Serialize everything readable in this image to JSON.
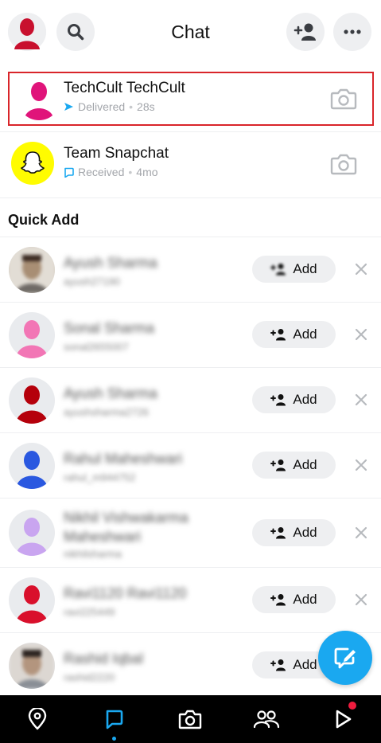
{
  "header": {
    "title": "Chat",
    "avatar_icon": "bitmoji-avatar-icon",
    "search_icon": "search-icon",
    "add_friend_icon": "add-friend-icon",
    "more_icon": "more-icon"
  },
  "chats": [
    {
      "name": "TechCult TechCult",
      "status": "Delivered",
      "time": "28s",
      "status_color": "#1aa8f0",
      "avatar_color": "#e0147a"
    },
    {
      "name": "Team Snapchat",
      "status": "Received",
      "time": "4mo",
      "status_color": "#1aa8f0",
      "avatar_color": "#fffc00"
    }
  ],
  "separator": "•",
  "quick_add": {
    "title": "Quick Add",
    "add_label": "Add",
    "items": [
      {
        "name": "Ayush Sharma",
        "username": "ayush27190",
        "avatar_color": "#c8b49a"
      },
      {
        "name": "Sonal Sharma",
        "username": "sonal2655007",
        "avatar_color": "#f276b5"
      },
      {
        "name": "Ayush Sharma",
        "username": "ayushsharma2726",
        "avatar_color": "#b5000b"
      },
      {
        "name": "Rahul Maheshwari",
        "username": "rahul_m944752",
        "avatar_color": "#2a58e0"
      },
      {
        "name": "Nikhil Vishwakarma Maheshwari",
        "username": "nikhilsharma",
        "avatar_color": "#c9a5f0"
      },
      {
        "name": "Ravi1120 Ravi1120",
        "username": "ravi225449",
        "avatar_color": "#d9102c"
      },
      {
        "name": "Rashid Iqbal",
        "username": "rashid2220",
        "avatar_color": "#b49c8a"
      }
    ]
  },
  "colors": {
    "accent": "#1aa8f0",
    "highlight_border": "#d9252a",
    "nav_background": "#000000"
  },
  "nav": [
    {
      "name": "map-icon"
    },
    {
      "name": "chat-icon"
    },
    {
      "name": "camera-icon"
    },
    {
      "name": "stories-icon"
    },
    {
      "name": "spotlight-icon"
    }
  ]
}
